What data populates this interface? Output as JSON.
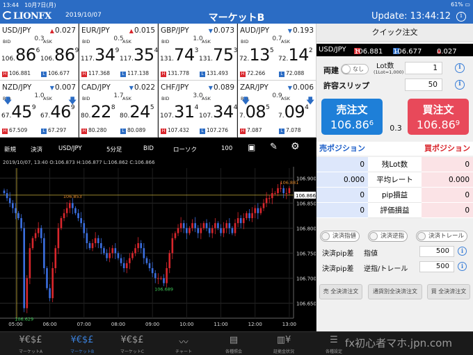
{
  "status_bar": {
    "time": "13:44",
    "date": "10月7日(月)",
    "battery": "61%"
  },
  "header": {
    "logo": "LIONFX",
    "date": "2019/10/07",
    "title": "マーケットB",
    "update": "Update: 13:44:12",
    "info_icon": "i"
  },
  "tiles": [
    {
      "pair": "USD/JPY",
      "dir": "up",
      "chg": "0.027",
      "spread": "0.3",
      "bid_pre": "106.",
      "bid_big": "86",
      "bid_sup": "6",
      "ask_pre": "106.",
      "ask_big": "86",
      "ask_sup": "9",
      "high": "106.881",
      "low": "106.677",
      "arrow": ""
    },
    {
      "pair": "EUR/JPY",
      "dir": "up",
      "chg": "0.015",
      "spread": "0.5",
      "bid_pre": "117.",
      "bid_big": "34",
      "bid_sup": "9",
      "ask_pre": "117.",
      "ask_big": "35",
      "ask_sup": "4",
      "high": "117.368",
      "low": "117.138",
      "arrow": ""
    },
    {
      "pair": "GBP/JPY",
      "dir": "down",
      "chg": "0.073",
      "spread": "1.0",
      "bid_pre": "131.",
      "bid_big": "74",
      "bid_sup": "3",
      "ask_pre": "131.",
      "ask_big": "75",
      "ask_sup": "3",
      "high": "131.778",
      "low": "131.493",
      "arrow": ""
    },
    {
      "pair": "AUD/JPY",
      "dir": "down",
      "chg": "0.193",
      "spread": "0.7",
      "bid_pre": "72.",
      "bid_big": "13",
      "bid_sup": "5",
      "ask_pre": "72.",
      "ask_big": "14",
      "ask_sup": "2",
      "high": "72.266",
      "low": "72.088",
      "arrow": ""
    },
    {
      "pair": "NZD/JPY",
      "dir": "down",
      "chg": "0.007",
      "spread": "1.0",
      "bid_pre": "67.",
      "bid_big": "45",
      "bid_sup": "9",
      "ask_pre": "67.",
      "ask_big": "46",
      "ask_sup": "9",
      "high": "67.509",
      "low": "67.297",
      "arrow": "down"
    },
    {
      "pair": "CAD/JPY",
      "dir": "down",
      "chg": "0.022",
      "spread": "1.7",
      "bid_pre": "80.",
      "bid_big": "22",
      "bid_sup": "8",
      "ask_pre": "80.",
      "ask_big": "24",
      "ask_sup": "5",
      "high": "80.280",
      "low": "80.089",
      "arrow": ""
    },
    {
      "pair": "CHF/JPY",
      "dir": "down",
      "chg": "0.089",
      "spread": "3.0",
      "bid_pre": "107.",
      "bid_big": "31",
      "bid_sup": "4",
      "ask_pre": "107.",
      "ask_big": "34",
      "ask_sup": "4",
      "high": "107.432",
      "low": "107.276",
      "arrow": ""
    },
    {
      "pair": "ZAR/JPY",
      "dir": "down",
      "chg": "0.006",
      "spread": "0.9",
      "bid_pre": "7.",
      "bid_big": "08",
      "bid_sup": "5",
      "ask_pre": "7.",
      "ask_big": "09",
      "ask_sup": "4",
      "high": "7.087",
      "low": "7.078",
      "arrow": "down"
    }
  ],
  "tile_labels": {
    "bid": "BID",
    "ask": "ASK",
    "high_badge": "H",
    "low_badge": "L"
  },
  "chart_toolbar": {
    "new": "新規",
    "settle": "決済",
    "pair": "USD/JPY",
    "period": "5分足",
    "side": "BID",
    "type": "ローソク",
    "count": "100"
  },
  "chart_info": "2019/10/07, 13:40   O:106.873   H:106.877   L:106.862   C:106.866",
  "chart_data": {
    "type": "candlestick",
    "x_ticks": [
      "05:00",
      "06:00",
      "07:00",
      "08:00",
      "09:00",
      "10:00",
      "11:00",
      "12:00",
      "13:00"
    ],
    "y_ticks": [
      "106.900",
      "106.850",
      "106.800",
      "106.750",
      "106.700",
      "106.650"
    ],
    "ylim": [
      106.62,
      106.92
    ],
    "current_label": "106.866",
    "annotations": [
      {
        "label": "106.853",
        "time_index": 24,
        "value": 106.853
      },
      {
        "label": "106.881",
        "time_index": 100,
        "value": 106.881
      },
      {
        "label": "106.689",
        "time_index": 56,
        "value": 106.689
      },
      {
        "label": "106.629",
        "time_index": 7,
        "value": 106.629
      }
    ],
    "close_path": [
      106.87,
      106.86,
      106.85,
      106.84,
      106.83,
      106.82,
      106.8,
      106.64,
      106.7,
      106.76,
      106.78,
      106.79,
      106.8,
      106.78,
      106.72,
      106.68,
      106.66,
      106.72,
      106.76,
      106.8,
      106.82,
      106.83,
      106.84,
      106.85,
      106.84,
      106.83,
      106.82,
      106.81,
      106.79,
      106.77,
      106.76,
      106.77,
      106.78,
      106.77,
      106.76,
      106.75,
      106.74,
      106.75,
      106.76,
      106.75,
      106.74,
      106.73,
      106.72,
      106.73,
      106.74,
      106.75,
      106.76,
      106.77,
      106.76,
      106.74,
      106.73,
      106.72,
      106.71,
      106.7,
      106.7,
      106.7,
      106.69,
      106.72,
      106.75,
      106.78,
      106.79,
      106.8,
      106.81,
      106.8,
      106.79,
      106.8,
      106.81,
      106.8,
      106.79,
      106.8,
      106.81,
      106.8,
      106.79,
      106.8,
      106.81,
      106.8,
      106.79,
      106.8,
      106.81,
      106.8,
      106.79,
      106.81,
      106.82,
      106.81,
      106.82,
      106.83,
      106.82,
      106.83,
      106.84,
      106.83,
      106.84,
      106.85,
      106.86,
      106.86,
      106.87,
      106.87,
      106.88,
      106.88,
      106.87,
      106.87,
      106.88
    ]
  },
  "nav": [
    {
      "icon": "¥€$£",
      "label": "マーケットA",
      "active": false
    },
    {
      "icon": "¥€$£",
      "label": "マーケットB",
      "active": true
    },
    {
      "icon": "¥€$£",
      "label": "マーケットC",
      "active": false
    },
    {
      "icon": "〰",
      "label": "チャート",
      "active": false
    },
    {
      "icon": "▤",
      "label": "各種照会",
      "active": false
    },
    {
      "icon": "▥¥",
      "label": "証拠金状況",
      "active": false
    },
    {
      "icon": "☰",
      "label": "各種設定",
      "active": false
    }
  ],
  "watermark": "fx初心者マホ.jpn.com",
  "panel": {
    "title": "クイック注文",
    "rate_pair": "USD/JPY",
    "rate_high": "106.881",
    "rate_low": "106.677",
    "rate_chg": "0.027",
    "ryodate_label": "両建",
    "ryodate_toggle": "なし",
    "lot_label": "Lot数",
    "lot_sub": "(1Lot=1,000)",
    "lot_value": "1",
    "slip_label": "許容スリップ",
    "slip_value": "50",
    "sell_label": "売注文",
    "sell_pre": "106.",
    "sell_big": "86",
    "sell_sup": "6",
    "spread": "0.3",
    "buy_label": "買注文",
    "buy_pre": "106.",
    "buy_big": "86",
    "buy_sup": "9",
    "sell_pos": "売ポジション",
    "buy_pos": "買ポジション",
    "rows": [
      {
        "l": "0",
        "m": "残Lot数",
        "r": "0"
      },
      {
        "l": "0.000",
        "m": "平均レート",
        "r": "0.000"
      },
      {
        "l": "0",
        "m": "pip損益",
        "r": "0"
      },
      {
        "l": "0",
        "m": "評価損益",
        "r": "0"
      }
    ],
    "chip1": "決済指値",
    "chip2": "決済逆指",
    "chip3": "決済トレール",
    "pip_label1": "決済pip差",
    "pip_sub1": "指値",
    "pip_val1": "500",
    "pip_label2": "決済pip差",
    "pip_sub2": "逆指/トレール",
    "pip_val2": "500",
    "btn1": "売 全決済注文",
    "btn2": "通貨別全決済注文",
    "btn3": "買 全決済注文"
  },
  "colors": {
    "header": "#2b6cc4",
    "sell": "#1e7fd8",
    "buy": "#e8495a",
    "up": "#d9262c",
    "down": "#2b6cc4"
  }
}
